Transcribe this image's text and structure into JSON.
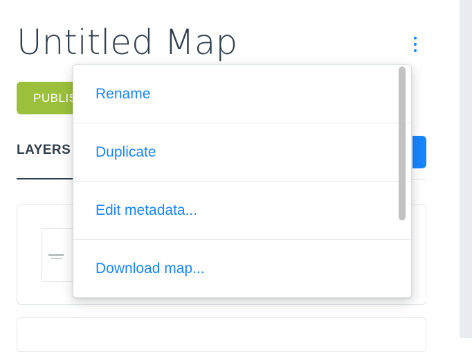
{
  "map": {
    "title": "Untitled Map",
    "publish_label": "PUBLISH"
  },
  "tabs": {
    "layers_label": "LAYERS"
  },
  "menu": {
    "items": [
      {
        "label": "Rename"
      },
      {
        "label": "Duplicate"
      },
      {
        "label": "Edit metadata..."
      },
      {
        "label": "Download map..."
      }
    ]
  },
  "colors": {
    "accent": "#1785fb",
    "publish": "#9bc13c",
    "title": "#2f3e4a"
  },
  "icons": {
    "more": "more-vertical-icon"
  }
}
